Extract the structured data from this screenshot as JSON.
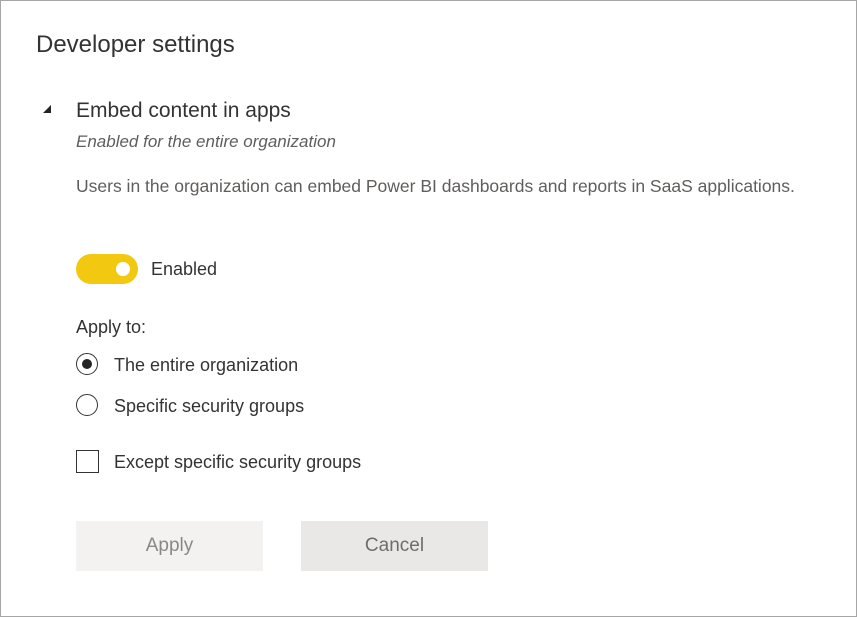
{
  "dialog": {
    "title": "Developer settings"
  },
  "section": {
    "title": "Embed content in apps",
    "status": "Enabled for the entire organization",
    "description": "Users in the organization can embed Power BI dashboards and reports in SaaS applications.",
    "collapse_icon": "triangle-collapse-icon"
  },
  "toggle": {
    "label": "Enabled",
    "on": true,
    "color": "#f2c811"
  },
  "apply_to": {
    "label": "Apply to:",
    "options": [
      {
        "label": "The entire organization",
        "selected": true
      },
      {
        "label": "Specific security groups",
        "selected": false
      }
    ]
  },
  "except": {
    "label": "Except specific security groups",
    "checked": false
  },
  "buttons": {
    "apply_label": "Apply",
    "cancel_label": "Cancel"
  }
}
